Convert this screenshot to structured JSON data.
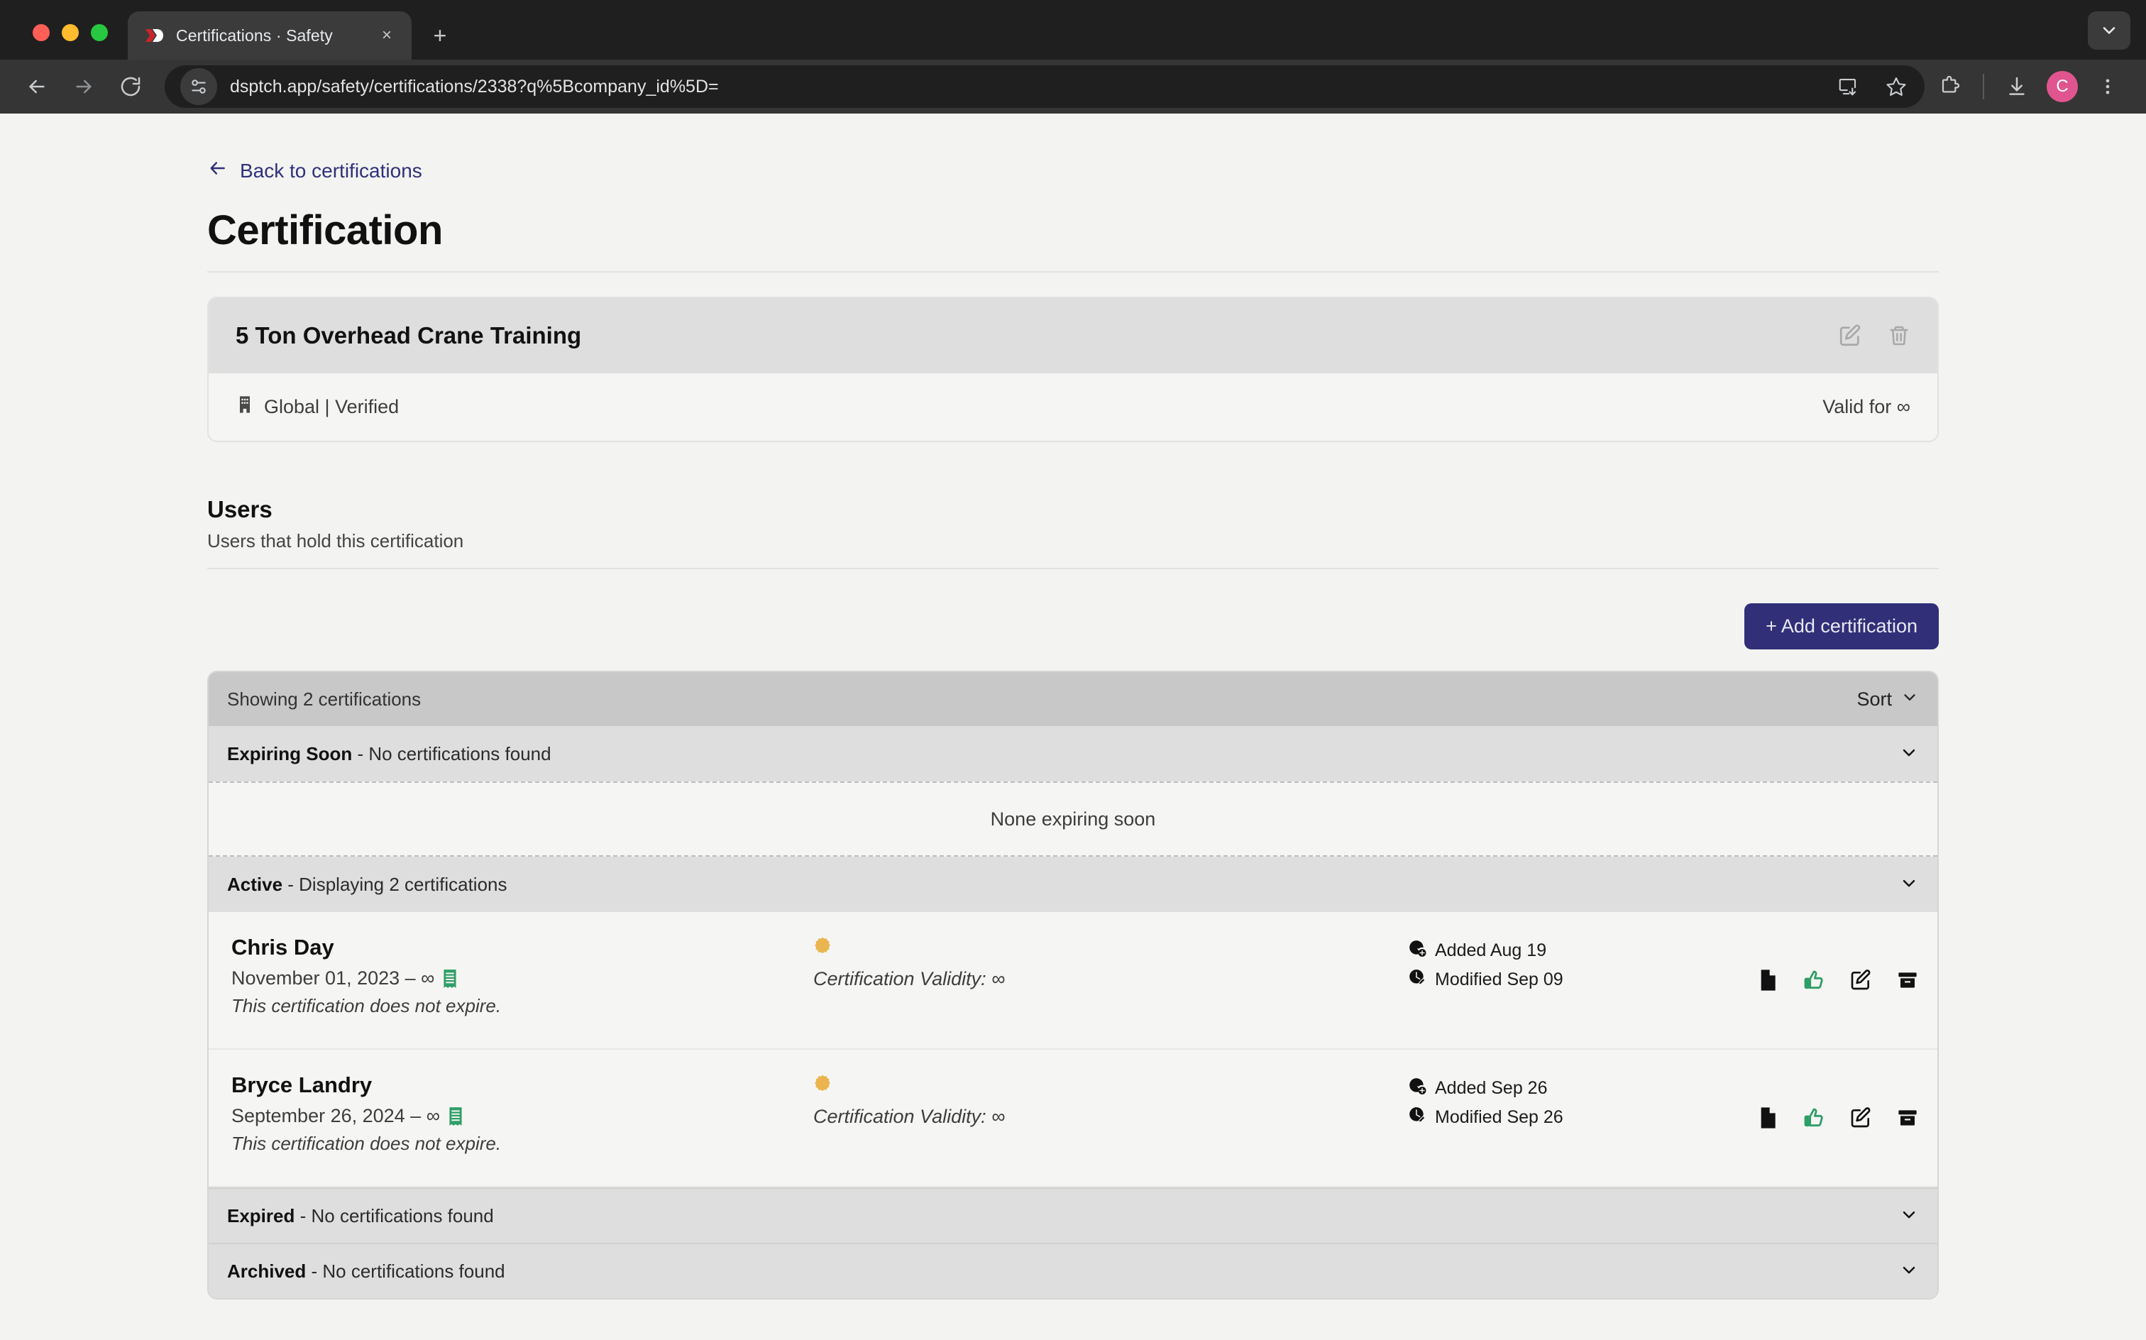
{
  "browser": {
    "tab": {
      "title": "Certifications · Safety",
      "favicon": "dispatch-logo-icon",
      "close": "×"
    },
    "new_tab_label": "+",
    "url": "dsptch.app/safety/certifications/2338?q%5Bcompany_id%5D=",
    "toolbar_icons": [
      "back-icon",
      "forward-icon",
      "reload-icon",
      "site-info-icon",
      "install-app-icon",
      "bookmark-star-icon",
      "extensions-icon",
      "downloads-icon",
      "chrome-menu-icon"
    ],
    "avatar_initial": "C"
  },
  "page": {
    "back_link": "Back to certifications",
    "title": "Certification"
  },
  "certification": {
    "name": "5 Ton Overhead Crane Training",
    "meta": "Global | Verified",
    "validity": "Valid for ∞",
    "edit_label": "edit-icon",
    "delete_label": "trash-icon"
  },
  "users_section": {
    "title": "Users",
    "subtitle": "Users that hold this certification",
    "add_button": "+ Add certification"
  },
  "list": {
    "showing": "Showing 2 certifications",
    "sort_label": "Sort",
    "groups": [
      {
        "title": "Expiring Soon",
        "summary": " - No certifications found",
        "empty_text": "None expiring soon"
      },
      {
        "title": "Active",
        "summary": " - Displaying 2 certifications"
      },
      {
        "title": "Expired",
        "summary": " - No certifications found"
      },
      {
        "title": "Archived",
        "summary": " - No certifications found"
      }
    ],
    "rows": [
      {
        "name": "Chris Day",
        "dates": "November 01, 2023 – ∞",
        "note": "This certification does not expire.",
        "validity": "Certification Validity: ∞",
        "added": "Added Aug 19",
        "modified": "Modified Sep 09"
      },
      {
        "name": "Bryce Landry",
        "dates": "September 26, 2024 – ∞",
        "note": "This certification does not expire.",
        "validity": "Certification Validity: ∞",
        "added": "Added Sep 26",
        "modified": "Modified Sep 26"
      }
    ]
  },
  "colors": {
    "accent": "#302f77",
    "link": "#30307a",
    "badge_amber": "#eab54e",
    "approve_green": "#2f9e68",
    "page_bg": "#f3f3f1",
    "avatar_pink": "#e0558f"
  }
}
